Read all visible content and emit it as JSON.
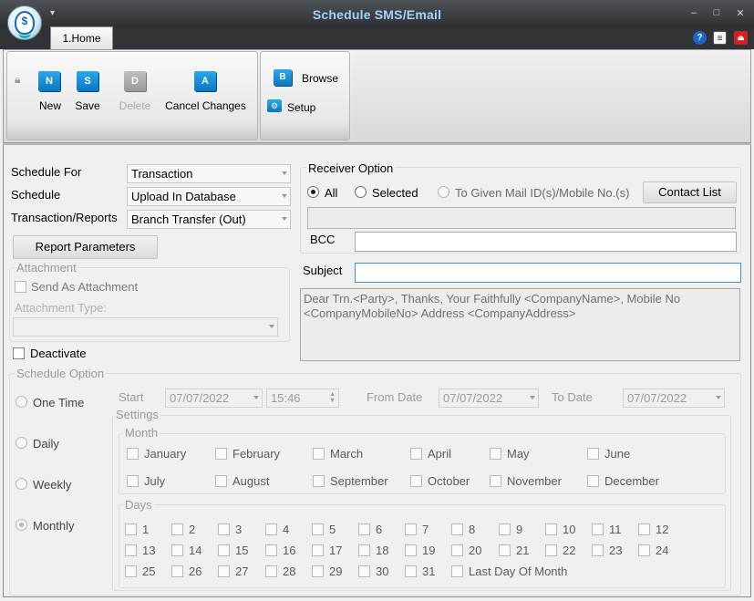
{
  "window": {
    "title": "Schedule SMS/Email",
    "quick_access_glyph": "▾",
    "minimize": "–",
    "maximize": "□",
    "close": "✕"
  },
  "tabs": [
    {
      "label": "1.Home"
    }
  ],
  "top_icons": [
    "help-icon",
    "notepad-icon",
    "exit-icon"
  ],
  "ribbon": {
    "record": {
      "new": "New",
      "save": "Save",
      "delete": "Delete",
      "cancel": "Cancel Changes",
      "new_icon": "N",
      "save_icon": "S",
      "delete_icon": "D",
      "cancel_icon": "A"
    },
    "nav": {
      "browse": "Browse",
      "setup": "Setup",
      "browse_icon": "B"
    }
  },
  "form": {
    "schedule_for_label": "Schedule For",
    "schedule_for_value": "Transaction",
    "schedule_label": "Schedule",
    "schedule_value": "Upload In Database",
    "transaction_label": "Transaction/Reports",
    "transaction_value": "Branch Transfer (Out)",
    "report_parameters": "Report Parameters",
    "attachment_group": "Attachment",
    "send_as_attachment": "Send As Attachment",
    "attachment_type_label": "Attachment Type:",
    "attachment_type_value": "",
    "deactivate": "Deactivate"
  },
  "receiver": {
    "group": "Receiver Option",
    "all": "All",
    "selected": "Selected",
    "given": "To Given Mail ID(s)/Mobile No.(s)",
    "contact_list": "Contact List",
    "to_value": "",
    "bcc_label": "BCC",
    "bcc_value": "",
    "subject_label": "Subject",
    "subject_value": "",
    "message": "Dear Trn.<Party>, Thanks, Your Faithfully <CompanyName>, Mobile No <CompanyMobileNo> Address <CompanyAddress>"
  },
  "schedule_option": {
    "group": "Schedule Option",
    "one_time": "One Time",
    "daily": "Daily",
    "weekly": "Weekly",
    "monthly": "Monthly",
    "start_label": "Start",
    "start_date": "07/07/2022",
    "start_time": "15:46",
    "from_date_label": "From Date",
    "from_date": "07/07/2022",
    "to_date_label": "To Date",
    "to_date": "07/07/2022",
    "settings": "Settings",
    "month_group": "Month",
    "months": [
      "January",
      "February",
      "March",
      "April",
      "May",
      "June",
      "July",
      "August",
      "September",
      "October",
      "November",
      "December"
    ],
    "days_group": "Days",
    "days": [
      "1",
      "2",
      "3",
      "4",
      "5",
      "6",
      "7",
      "8",
      "9",
      "10",
      "11",
      "12",
      "13",
      "14",
      "15",
      "16",
      "17",
      "18",
      "19",
      "20",
      "21",
      "22",
      "23",
      "24",
      "25",
      "26",
      "27",
      "28",
      "29",
      "30",
      "31"
    ],
    "last_day": "Last Day Of Month"
  }
}
